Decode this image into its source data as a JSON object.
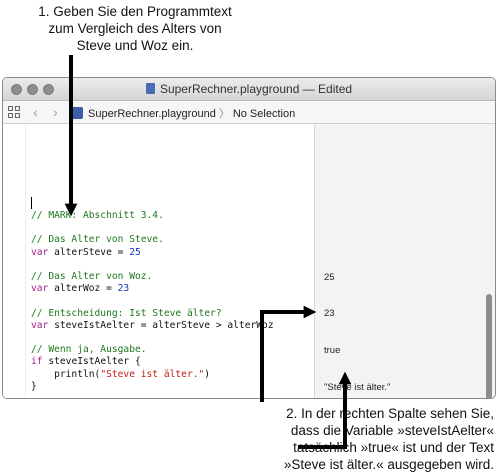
{
  "callouts": {
    "top": [
      "1. Geben Sie den Programmtext",
      "zum Vergleich des Alters von",
      "Steve und Woz ein."
    ],
    "bottom": [
      "2. In der rechten Spalte sehen Sie,",
      "dass die Variable »steveIstAelter«",
      "tatsächlich »true« ist und der Text",
      "»Steve ist älter.« ausgegeben wird."
    ]
  },
  "window": {
    "title": "SuperRechner.playground — Edited",
    "breadcrumb": {
      "file": "SuperRechner.playground",
      "selection": "No Selection"
    }
  },
  "code": {
    "mark": "// MARK: Abschnitt 3.4.",
    "comment1": "// Das Alter von Steve.",
    "var1_kw": "var",
    "var1_name": " alterSteve = ",
    "var1_val": "25",
    "comment2": "// Das Alter von Woz.",
    "var2_kw": "var",
    "var2_name": " alterWoz = ",
    "var2_val": "23",
    "comment3": "// Entscheidung: Ist Steve älter?",
    "var3_kw": "var",
    "var3_rest": " steveIstAelter = alterSteve > alterWoz",
    "comment4": "// Wenn ja, Ausgabe.",
    "if_kw": "if",
    "if_rest": " steveIstAelter {",
    "println_pre": "    println(",
    "println_str": "\"Steve ist älter.\"",
    "println_post": ")",
    "close": "}"
  },
  "results": {
    "alterSteve": "25",
    "alterWoz": "23",
    "steveIstAelter": "true",
    "println": "\"Steve ist älter.\""
  }
}
